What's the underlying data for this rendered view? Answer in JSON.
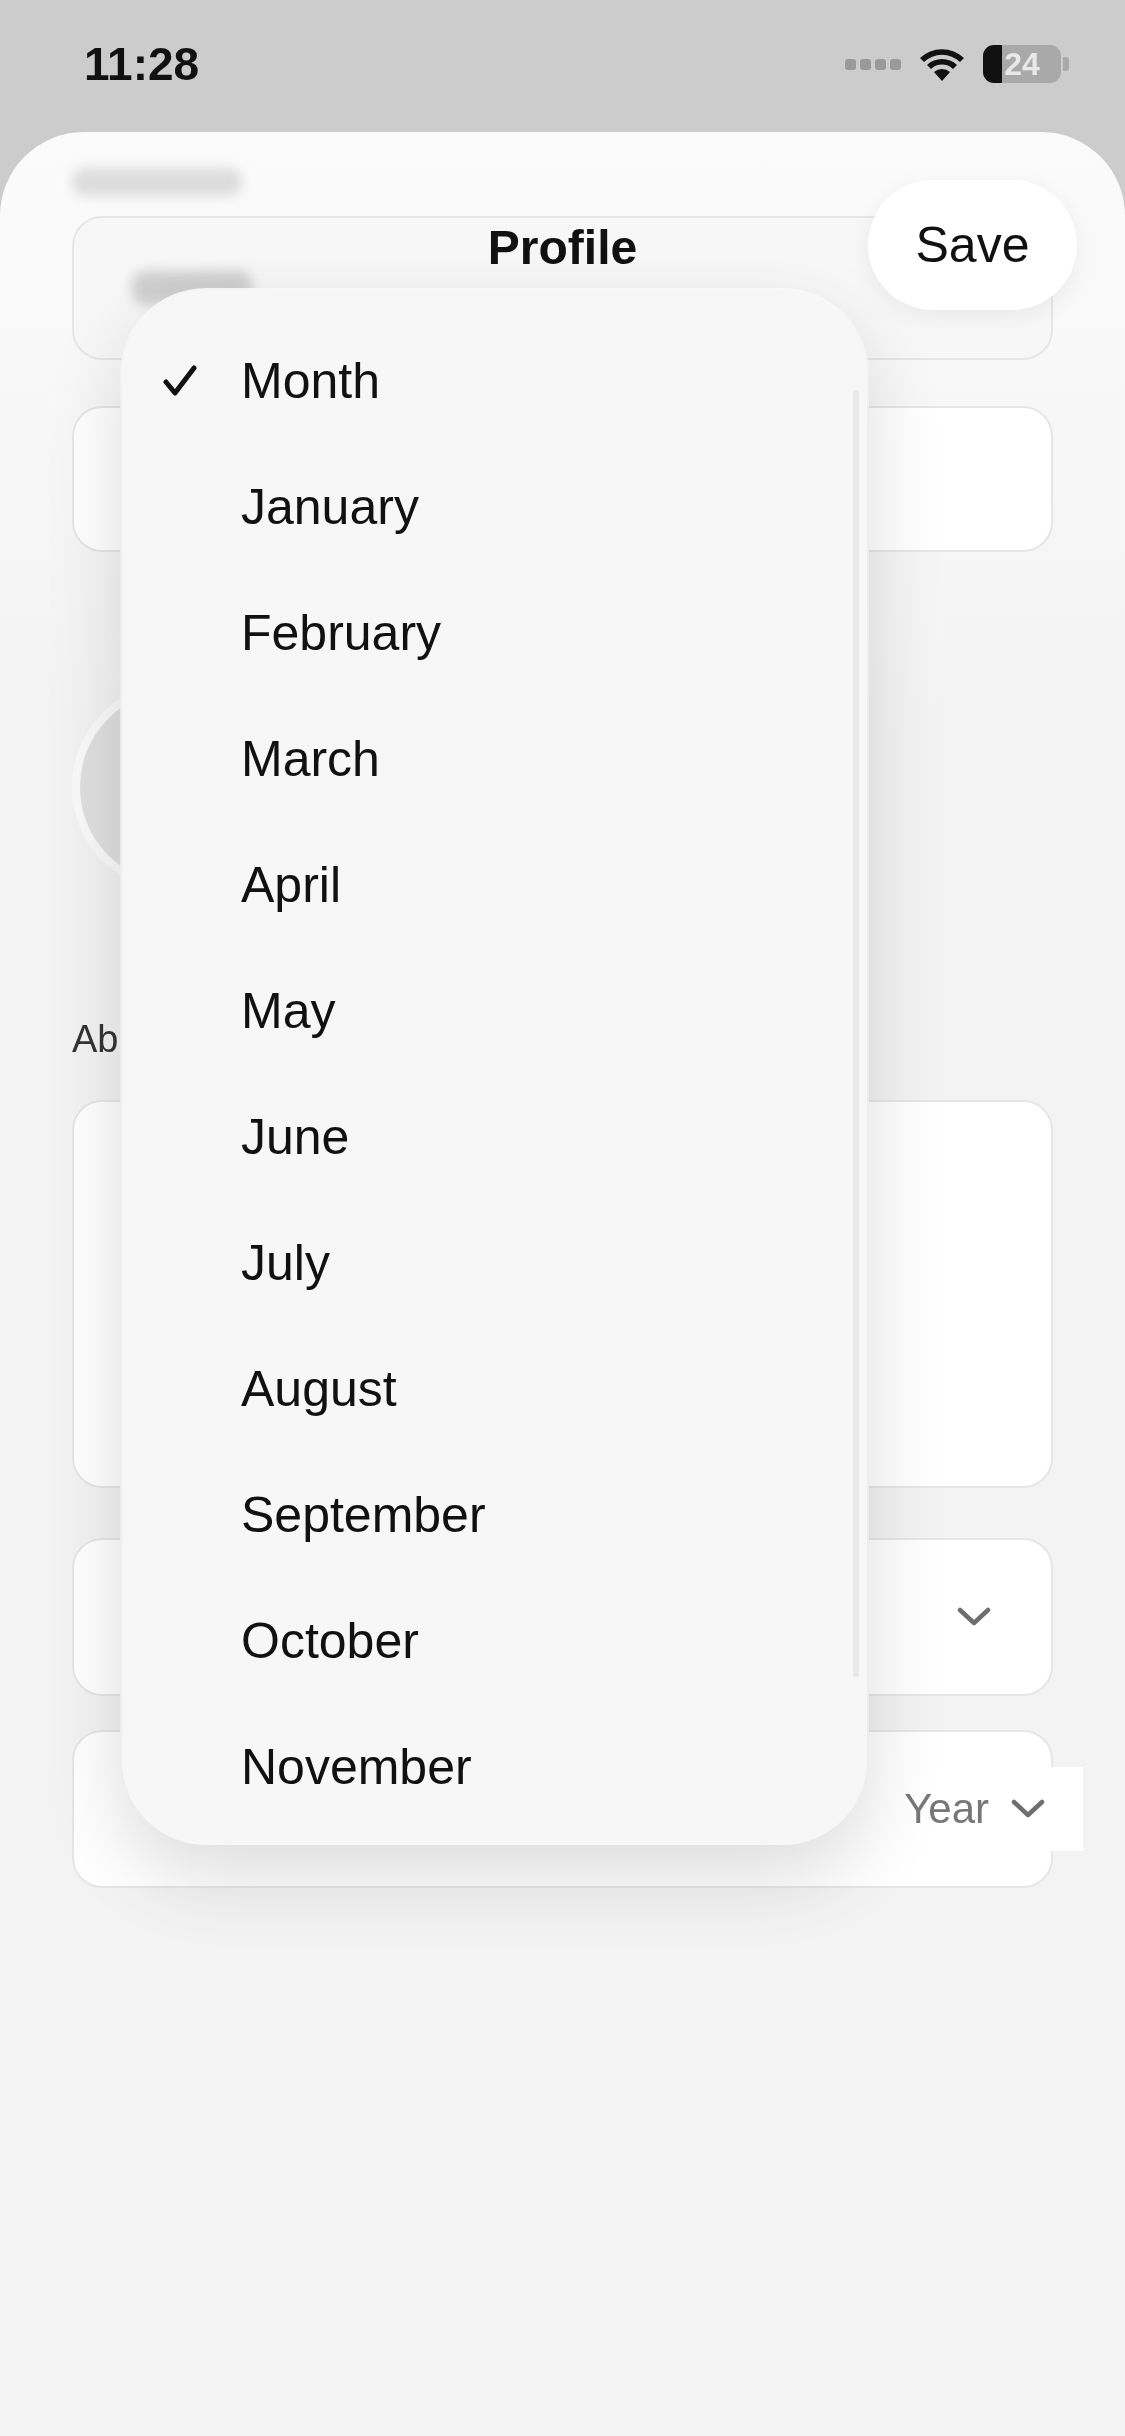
{
  "status_bar": {
    "time": "11:28",
    "battery": "24"
  },
  "header": {
    "title": "Profile",
    "save_button": "Save"
  },
  "form": {
    "about_label": "Ab",
    "year_placeholder": "Year"
  },
  "menu": {
    "items": [
      {
        "label": "Month",
        "selected": true
      },
      {
        "label": "January",
        "selected": false
      },
      {
        "label": "February",
        "selected": false
      },
      {
        "label": "March",
        "selected": false
      },
      {
        "label": "April",
        "selected": false
      },
      {
        "label": "May",
        "selected": false
      },
      {
        "label": "June",
        "selected": false
      },
      {
        "label": "July",
        "selected": false
      },
      {
        "label": "August",
        "selected": false
      },
      {
        "label": "September",
        "selected": false
      },
      {
        "label": "October",
        "selected": false
      },
      {
        "label": "November",
        "selected": false
      }
    ]
  }
}
